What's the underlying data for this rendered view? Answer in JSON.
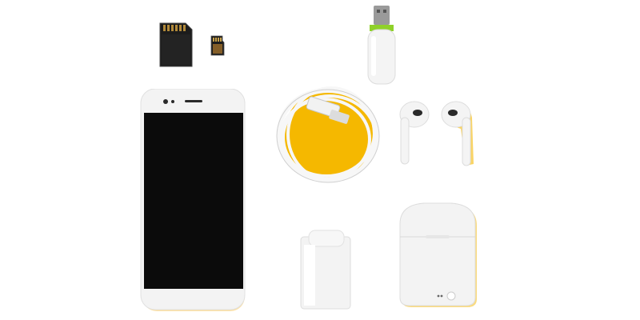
{
  "scene": {
    "objects": [
      "sd-card",
      "microsd-card",
      "usb-flash-drive",
      "smartphone",
      "usb-cable",
      "wireless-earbuds",
      "charger-plug",
      "earbuds-charging-case"
    ]
  },
  "colors": {
    "background": "#ffffff",
    "accent_yellow": "#f5b800",
    "device_white": "#f2f2f2",
    "screen_black": "#0c0c0c",
    "usb_green": "#8fd12a"
  }
}
